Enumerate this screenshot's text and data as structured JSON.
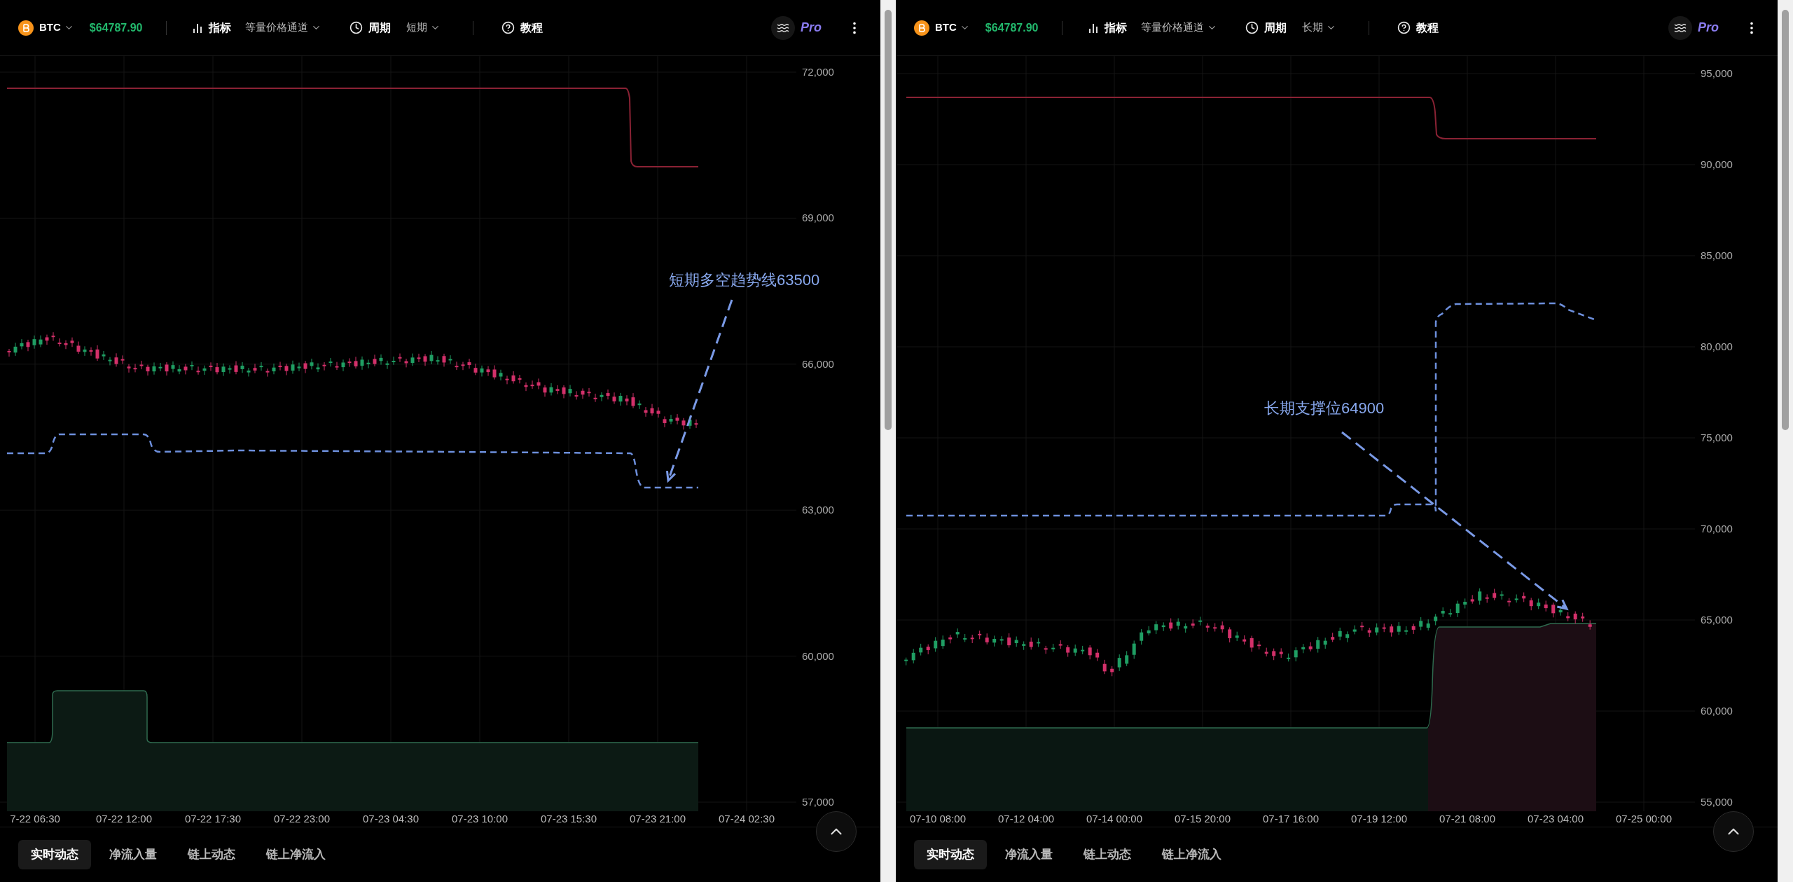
{
  "panels": [
    {
      "kind": "short",
      "asset": "BTC",
      "price": "$64787.90",
      "indicator_label": "指标",
      "indicator_value": "等量价格通道",
      "period_label": "周期",
      "period_value": "短期",
      "tutorial": "教程",
      "pro_label": "Pro",
      "annotation": "短期多空趋势线63500",
      "y_axis_labels": [
        "72,000",
        "69,000",
        "66,000",
        "63,000",
        "60,000",
        "57,000"
      ],
      "x_axis_labels": [
        "7-22 06:30",
        "07-22 12:00",
        "07-22 17:30",
        "07-22 23:00",
        "07-23 04:30",
        "07-23 10:00",
        "07-23 15:30",
        "07-23 21:00",
        "07-24 02:30"
      ],
      "tabs": [
        {
          "label": "实时动态",
          "selected": true
        },
        {
          "label": "净流入量",
          "selected": false
        },
        {
          "label": "链上动态",
          "selected": false
        },
        {
          "label": "链上净流入",
          "selected": false
        }
      ]
    },
    {
      "kind": "long",
      "asset": "BTC",
      "price": "$64787.90",
      "indicator_label": "指标",
      "indicator_value": "等量价格通道",
      "period_label": "周期",
      "period_value": "长期",
      "tutorial": "教程",
      "pro_label": "Pro",
      "annotation": "长期支撑位64900",
      "y_axis_labels": [
        "95,000",
        "90,000",
        "85,000",
        "80,000",
        "75,000",
        "70,000",
        "65,000",
        "60,000",
        "55,000"
      ],
      "x_axis_labels": [
        "07-10 08:00",
        "07-12 04:00",
        "07-14 00:00",
        "07-15 20:00",
        "07-17 16:00",
        "07-19 12:00",
        "07-21 08:00",
        "07-23 04:00",
        "07-25 00:00"
      ],
      "tabs": [
        {
          "label": "实时动态",
          "selected": true
        },
        {
          "label": "净流入量",
          "selected": false
        },
        {
          "label": "链上动态",
          "selected": false
        },
        {
          "label": "链上净流入",
          "selected": false
        }
      ]
    }
  ]
}
